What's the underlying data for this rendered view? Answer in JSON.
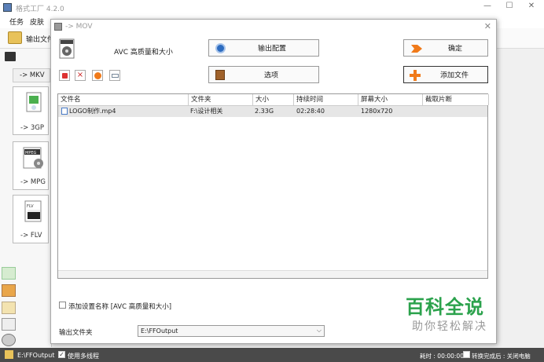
{
  "app": {
    "title": "格式工厂 4.2.0",
    "menu": [
      "任务",
      "皮肤"
    ],
    "toolbar": {
      "output_folder_label": "输出文件"
    }
  },
  "left_panel": {
    "mkv_button": "-> MKV",
    "formats": [
      {
        "label": "-> 3GP",
        "icon": "3gp-file-icon"
      },
      {
        "label": "-> MPG",
        "icon": "mpeg-file-icon"
      },
      {
        "label": "-> FLV",
        "icon": "flv-file-icon"
      }
    ]
  },
  "dialog": {
    "title": "-> MOV",
    "quality_label": "AVC 高质量和大小",
    "output_config_button": "输出配置",
    "options_button": "选项",
    "ok_button": "确定",
    "add_file_button": "添加文件",
    "table": {
      "columns": [
        "文件名",
        "文件夹",
        "大小",
        "持续时间",
        "屏幕大小",
        "截取片断"
      ],
      "rows": [
        {
          "name": "LOGO制作.mp4",
          "folder": "F:\\设计相关",
          "size": "2.33G",
          "duration": "02:28:40",
          "screen": "1280x720",
          "clip": ""
        }
      ]
    },
    "add_setting_name_label": "添加设置名称 [AVC 高质量和大小]",
    "output_folder_label": "输出文件夹",
    "output_folder_value": "E:\\FFOutput"
  },
  "statusbar": {
    "path": "E:\\FFOutput",
    "multithread_label": "使用多线程",
    "elapsed": "耗时 : 00:00:00",
    "after_complete": "转换完成后 : 关闭电脑"
  },
  "watermark": {
    "main": "百科全说",
    "sub": "助你轻松解决"
  },
  "colors": {
    "accent_orange": "#f07a1a",
    "watermark_green": "#2ba24c",
    "statusbar": "#4a4a4a"
  }
}
